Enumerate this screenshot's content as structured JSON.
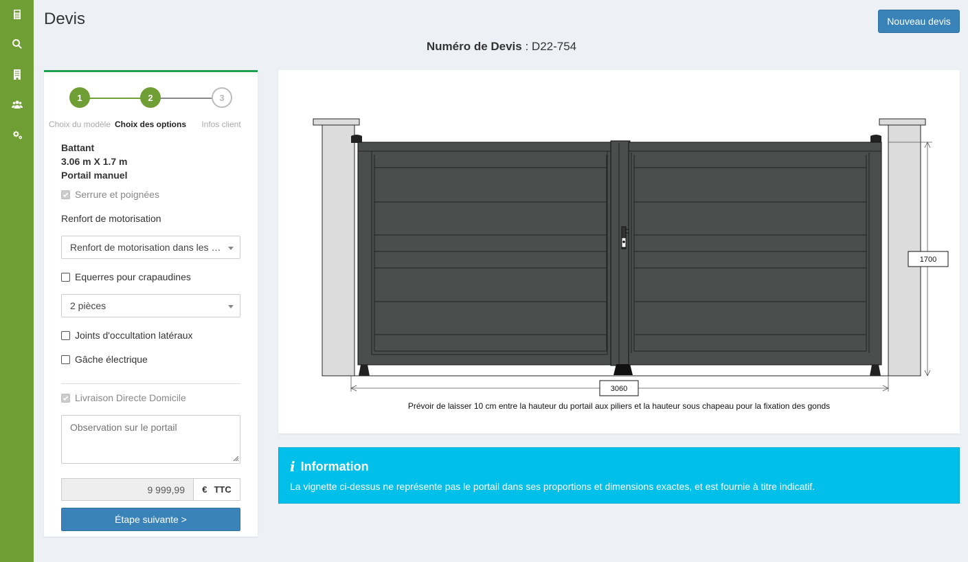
{
  "sidebar": {
    "items": [
      {
        "icon": "calculator-icon"
      },
      {
        "icon": "search-icon"
      },
      {
        "icon": "building-icon"
      },
      {
        "icon": "users-icon"
      },
      {
        "icon": "cogs-icon"
      }
    ],
    "color": "#6f9e35"
  },
  "header": {
    "title": "Devis",
    "new_button": "Nouveau devis",
    "quote_label": "Numéro de Devis",
    "quote_separator": " : ",
    "quote_value": "D22-754"
  },
  "stepper": {
    "steps": [
      {
        "number": "1",
        "label": "Choix du modèle",
        "state": "done"
      },
      {
        "number": "2",
        "label": "Choix des options",
        "state": "active"
      },
      {
        "number": "3",
        "label": "Infos client",
        "state": "todo"
      }
    ]
  },
  "summary": {
    "type": "Battant",
    "dimensions": "3.06 m X 1.7 m",
    "mode": "Portail manuel"
  },
  "options": {
    "lock": {
      "label": "Serrure et poignées",
      "checked": true,
      "disabled": true
    },
    "motor_label": "Renfort de motorisation",
    "motor_select": "Renfort de motorisation dans les …",
    "brackets": {
      "label": "Equerres pour crapaudines",
      "checked": false
    },
    "pieces_select": "2 pièces",
    "seals": {
      "label": "Joints d'occultation latéraux",
      "checked": false
    },
    "strike": {
      "label": "Gâche électrique",
      "checked": false
    },
    "delivery": {
      "label": "Livraison Directe Domicile",
      "checked": true,
      "disabled": true
    },
    "observation_placeholder": "Observation sur le portail"
  },
  "price": {
    "value": "9 999,99",
    "currency": "€",
    "tax": "TTC"
  },
  "next_button": "Étape suivante >",
  "drawing": {
    "height_dim": "1700",
    "width_dim": "3060",
    "note": "Prévoir de laisser 10 cm entre la hauteur du portail aux piliers et la hauteur sous chapeau pour la fixation des gonds",
    "gate_color": "#4a4f4d"
  },
  "info": {
    "title": "Information",
    "text": "La vignette ci-dessus ne représente pas le portail dans ses proportions et dimensions exactes, et est fournie à titre indicatif."
  }
}
